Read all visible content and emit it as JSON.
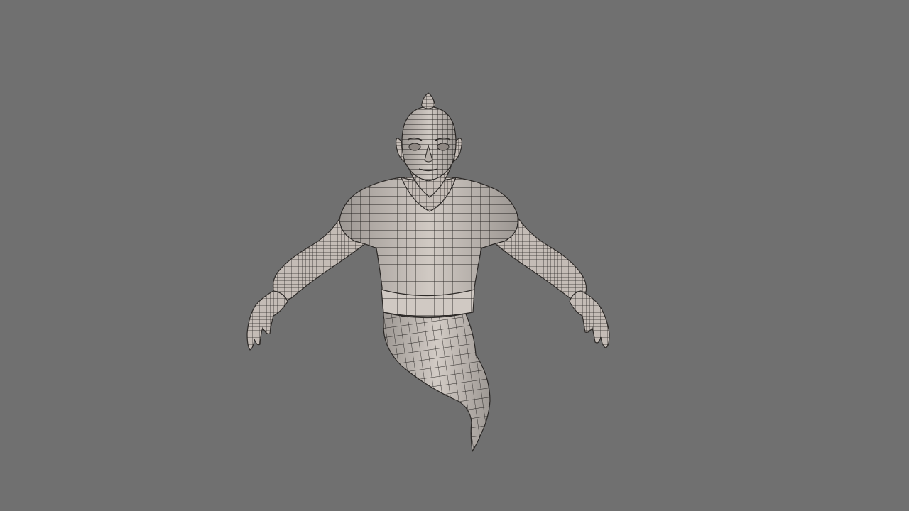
{
  "viewport": {
    "background_color": "#707070"
  },
  "model": {
    "kind": "genie character wireframe mesh",
    "display_mode": "wireframe-on-shaded",
    "surface_color": "#cfc8c2",
    "wire_color": "#2e2b29"
  }
}
